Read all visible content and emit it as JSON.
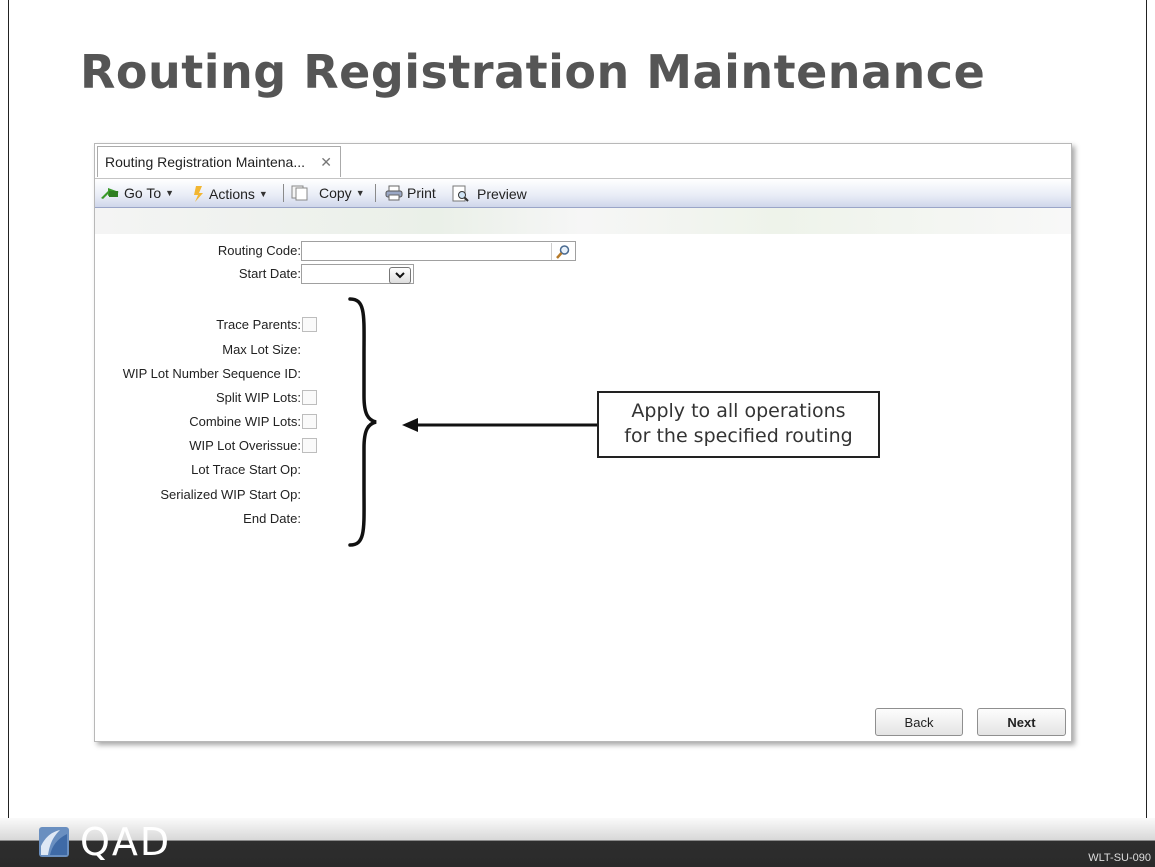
{
  "slide": {
    "title": "Routing Registration Maintenance",
    "slide_code": "WLT-SU-090",
    "logo_text": "QAD"
  },
  "window": {
    "tab_label": "Routing Registration Maintena...",
    "toolbar": {
      "goto_label": "Go To",
      "actions_label": "Actions",
      "copy_label": "Copy",
      "print_label": "Print",
      "preview_label": "Preview"
    },
    "form": {
      "routing_code_label": "Routing Code:",
      "routing_code_value": "",
      "start_date_label": "Start Date:",
      "start_date_value": "",
      "trace_parents_label": "Trace Parents:",
      "trace_parents_checked": false,
      "max_lot_size_label": "Max Lot Size:",
      "wip_lot_seq_label": "WIP Lot Number Sequence ID:",
      "split_wip_label": "Split WIP Lots:",
      "split_wip_checked": false,
      "combine_wip_label": "Combine WIP Lots:",
      "combine_wip_checked": false,
      "wip_overissue_label": "WIP Lot Overissue:",
      "wip_overissue_checked": false,
      "lot_trace_start_label": "Lot Trace Start Op:",
      "serialized_wip_label": "Serialized WIP Start Op:",
      "end_date_label": "End Date:"
    },
    "buttons": {
      "back": "Back",
      "next": "Next"
    }
  },
  "callout": {
    "line1": "Apply to all operations",
    "line2": "for the specified routing"
  },
  "colors": {
    "title": "#555555",
    "toolbar_bottom": "#cfd6ea",
    "footer": "#2a2a2a",
    "logo_blue": "#6a8fc0"
  },
  "icons": [
    "green-arrow-icon",
    "actions-flag-icon",
    "copy-icon",
    "printer-icon",
    "preview-icon",
    "magnifier-icon",
    "chevron-down-icon",
    "close-icon",
    "qad-logo-icon"
  ]
}
